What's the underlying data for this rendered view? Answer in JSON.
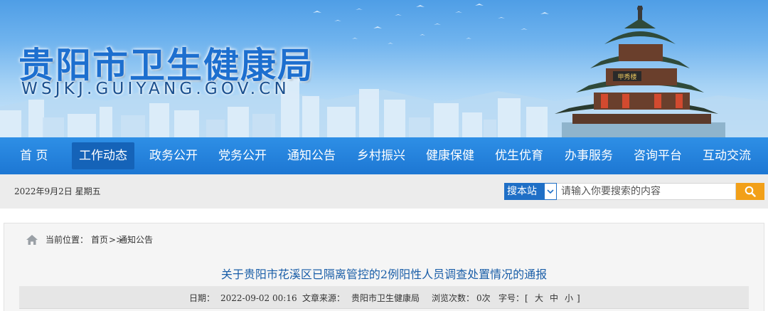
{
  "header": {
    "site_title": "贵阳市卫生健康局",
    "site_domain": "WSJKJ.GUIYANG.GOV.CN",
    "pavilion_plaque": "甲秀楼"
  },
  "nav": {
    "items": [
      {
        "label": "首  页"
      },
      {
        "label": "工作动态",
        "active": true
      },
      {
        "label": "政务公开"
      },
      {
        "label": "党务公开"
      },
      {
        "label": "通知公告"
      },
      {
        "label": "乡村振兴"
      },
      {
        "label": "健康保健"
      },
      {
        "label": "优生优育"
      },
      {
        "label": "办事服务"
      },
      {
        "label": "咨询平台"
      },
      {
        "label": "互动交流"
      }
    ]
  },
  "infobar": {
    "date": "2022年9月2日  星期五",
    "search_scope": "搜本站",
    "search_placeholder": "请输入你要搜索的内容",
    "search_icon": "search-icon"
  },
  "breadcrumb": {
    "label": "当前位置：",
    "home": "首页",
    "separator": ">>",
    "current": "通知公告",
    "icon": "home-icon"
  },
  "article": {
    "title": "关于贵阳市花溪区已隔离管控的2例阳性人员调查处置情况的通报",
    "date_label": "日期：",
    "date_value": "2022-09-02 00:16",
    "source_label": "文章来源：",
    "source_value": "贵阳市卫生健康局",
    "views_label": "浏览次数：",
    "views_value": "0次",
    "font_label": "字号：",
    "bracket_open": "[",
    "font_large": "大",
    "font_medium": "中",
    "font_small": "小",
    "bracket_close": "]"
  },
  "colors": {
    "nav_bg": "#1d77d3",
    "nav_active_bg": "#1563b8",
    "title_blue": "#1d6fcf",
    "search_button": "#f2a019",
    "article_title": "#1a5ea8"
  }
}
